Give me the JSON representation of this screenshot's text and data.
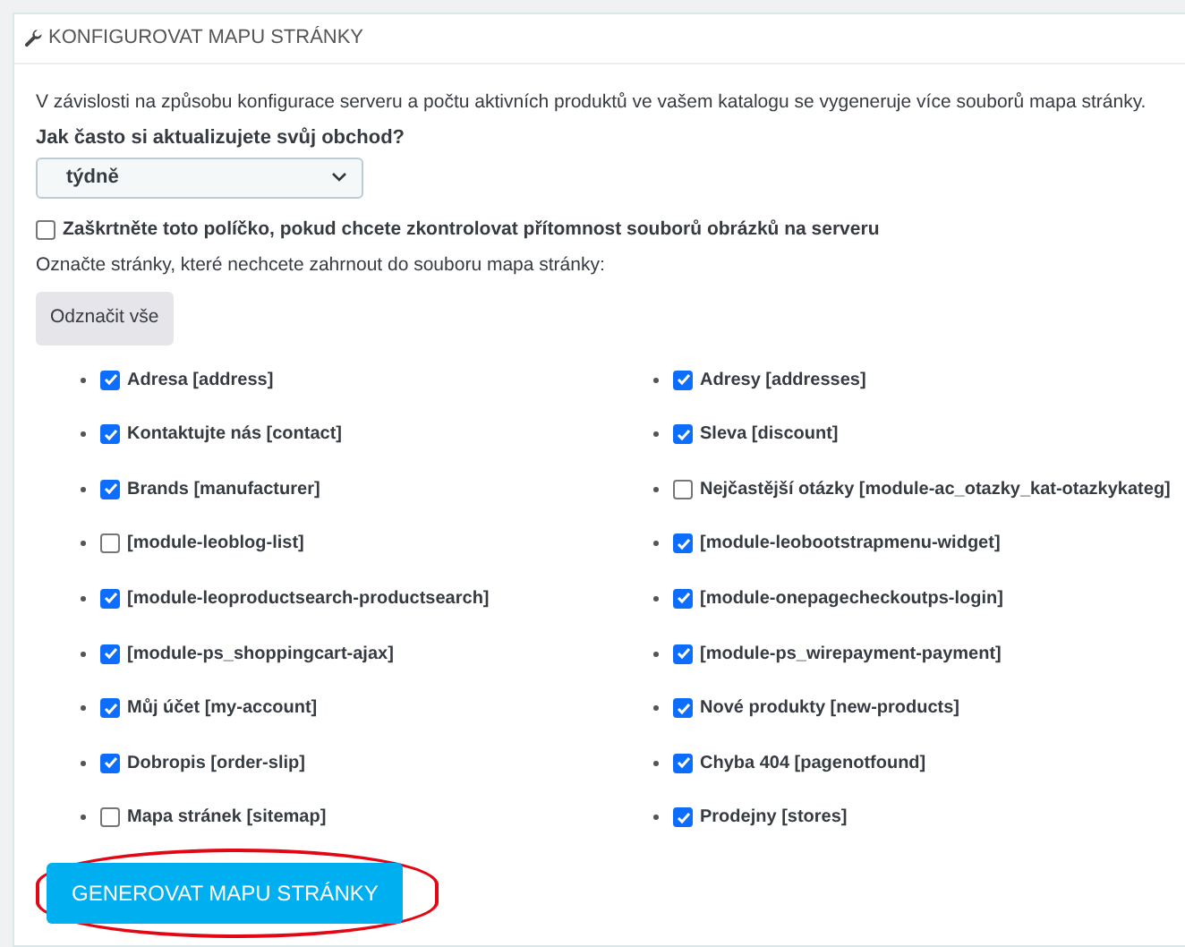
{
  "panel": {
    "title": "KONFIGUROVAT MAPU STRÁNKY"
  },
  "intro": "V závislosti na způsobu konfigurace serveru a počtu aktivních produktů ve vašem katalogu se vygeneruje více souborů mapa stránky.",
  "frequency": {
    "label": "Jak často si aktualizujete svůj obchod?",
    "value": "týdně"
  },
  "image_check": {
    "label": "Zaškrtněte toto políčko, pokud chcete zkontrolovat přítomnost souborů obrázků na serveru",
    "checked": false
  },
  "pages_label": "Označte stránky, které nechcete zahrnout do souboru mapa stránky:",
  "select_all_button": "Odznačit vše",
  "pages": [
    {
      "label": "Adresa [address]",
      "checked": true
    },
    {
      "label": "Adresy [addresses]",
      "checked": true
    },
    {
      "label": "Kontaktujte nás [contact]",
      "checked": true
    },
    {
      "label": "Sleva [discount]",
      "checked": true
    },
    {
      "label": "Brands [manufacturer]",
      "checked": true
    },
    {
      "label": "Nejčastější otázky [module-ac_otazky_kat-otazkykateg]",
      "checked": false
    },
    {
      "label": "[module-leoblog-list]",
      "checked": false
    },
    {
      "label": "[module-leobootstrapmenu-widget]",
      "checked": true
    },
    {
      "label": "[module-leoproductsearch-productsearch]",
      "checked": true
    },
    {
      "label": "[module-onepagecheckoutps-login]",
      "checked": true
    },
    {
      "label": "[module-ps_shoppingcart-ajax]",
      "checked": true
    },
    {
      "label": "[module-ps_wirepayment-payment]",
      "checked": true
    },
    {
      "label": "Můj účet [my-account]",
      "checked": true
    },
    {
      "label": "Nové produkty [new-products]",
      "checked": true
    },
    {
      "label": "Dobropis [order-slip]",
      "checked": true
    },
    {
      "label": "Chyba 404 [pagenotfound]",
      "checked": true
    },
    {
      "label": "Mapa stránek [sitemap]",
      "checked": false
    },
    {
      "label": "Prodejny [stores]",
      "checked": true
    }
  ],
  "generate_button": {
    "label": "GENEROVAT MAPU STRÁNKY",
    "highlighted": true
  }
}
